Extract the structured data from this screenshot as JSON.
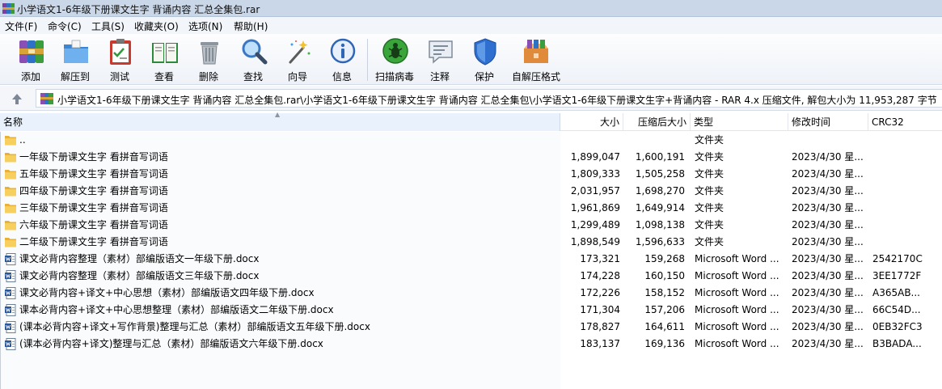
{
  "window": {
    "title": "小学语文1-6年级下册课文生字 背诵内容 汇总全集包.rar"
  },
  "menu": [
    "文件(F)",
    "命令(C)",
    "工具(S)",
    "收藏夹(O)",
    "选项(N)",
    "帮助(H)"
  ],
  "toolbar": {
    "buttons": [
      {
        "label": "添加",
        "icon": "add-archive-icon"
      },
      {
        "label": "解压到",
        "icon": "extract-folder-icon"
      },
      {
        "label": "测试",
        "icon": "test-clipboard-icon"
      },
      {
        "label": "查看",
        "icon": "view-book-icon"
      },
      {
        "label": "删除",
        "icon": "trash-bin-icon"
      },
      {
        "label": "查找",
        "icon": "magnifier-icon"
      },
      {
        "label": "向导",
        "icon": "wizard-wand-icon"
      },
      {
        "label": "信息",
        "icon": "info-icon"
      },
      {
        "label": "扫描病毒",
        "icon": "virus-scan-icon"
      },
      {
        "label": "注释",
        "icon": "comment-icon"
      },
      {
        "label": "保护",
        "icon": "shield-icon"
      },
      {
        "label": "自解压格式",
        "icon": "sfx-box-icon"
      }
    ]
  },
  "pathbar": {
    "path": "小学语文1-6年级下册课文生字 背诵内容 汇总全集包.rar\\小学语文1-6年级下册课文生字 背诵内容 汇总全集包\\小学语文1-6年级下册课文生字+背诵内容 - RAR 4.x 压缩文件, 解包大小为 11,953,287 字节"
  },
  "columns": {
    "name": "名称",
    "size": "大小",
    "packed": "压缩后大小",
    "type": "类型",
    "modified": "修改时间",
    "crc": "CRC32"
  },
  "rows": [
    {
      "kind": "folder",
      "name": "..",
      "size": "",
      "packed": "",
      "type": "文件夹",
      "modified": "",
      "crc": ""
    },
    {
      "kind": "folder",
      "name": "一年级下册课文生字 看拼音写词语",
      "size": "1,899,047",
      "packed": "1,600,191",
      "type": "文件夹",
      "modified": "2023/4/30 星...",
      "crc": ""
    },
    {
      "kind": "folder",
      "name": "五年级下册课文生字 看拼音写词语",
      "size": "1,809,333",
      "packed": "1,505,258",
      "type": "文件夹",
      "modified": "2023/4/30 星...",
      "crc": ""
    },
    {
      "kind": "folder",
      "name": "四年级下册课文生字 看拼音写词语",
      "size": "2,031,957",
      "packed": "1,698,270",
      "type": "文件夹",
      "modified": "2023/4/30 星...",
      "crc": ""
    },
    {
      "kind": "folder",
      "name": "三年级下册课文生字 看拼音写词语",
      "size": "1,961,869",
      "packed": "1,649,914",
      "type": "文件夹",
      "modified": "2023/4/30 星...",
      "crc": ""
    },
    {
      "kind": "folder",
      "name": "六年级下册课文生字 看拼音写词语",
      "size": "1,299,489",
      "packed": "1,098,138",
      "type": "文件夹",
      "modified": "2023/4/30 星...",
      "crc": ""
    },
    {
      "kind": "folder",
      "name": "二年级下册课文生字 看拼音写词语",
      "size": "1,898,549",
      "packed": "1,596,633",
      "type": "文件夹",
      "modified": "2023/4/30 星...",
      "crc": ""
    },
    {
      "kind": "docx",
      "name": "课文必背内容整理（素材）部编版语文一年级下册.docx",
      "size": "173,321",
      "packed": "159,268",
      "type": "Microsoft Word ...",
      "modified": "2023/4/30 星...",
      "crc": "2542170C"
    },
    {
      "kind": "docx",
      "name": "课文必背内容整理（素材）部编版语文三年级下册.docx",
      "size": "174,228",
      "packed": "160,150",
      "type": "Microsoft Word ...",
      "modified": "2023/4/30 星...",
      "crc": "3EE1772F"
    },
    {
      "kind": "docx",
      "name": "课文必背内容+译文+中心思想（素材）部编版语文四年级下册.docx",
      "size": "172,226",
      "packed": "158,152",
      "type": "Microsoft Word ...",
      "modified": "2023/4/30 星...",
      "crc": "A365AB..."
    },
    {
      "kind": "docx",
      "name": "课本必背内容+译文+中心思想整理（素材）部编版语文二年级下册.docx",
      "size": "171,304",
      "packed": "157,206",
      "type": "Microsoft Word ...",
      "modified": "2023/4/30 星...",
      "crc": "66C54D..."
    },
    {
      "kind": "docx",
      "name": "(课本必背内容+译文+写作背景)整理与汇总（素材）部编版语文五年级下册.docx",
      "size": "178,827",
      "packed": "164,611",
      "type": "Microsoft Word ...",
      "modified": "2023/4/30 星...",
      "crc": "0EB32FC3"
    },
    {
      "kind": "docx",
      "name": "(课本必背内容+译文)整理与汇总（素材）部编版语文六年级下册.docx",
      "size": "183,137",
      "packed": "169,136",
      "type": "Microsoft Word ...",
      "modified": "2023/4/30 星...",
      "crc": "B3BADA..."
    }
  ]
}
